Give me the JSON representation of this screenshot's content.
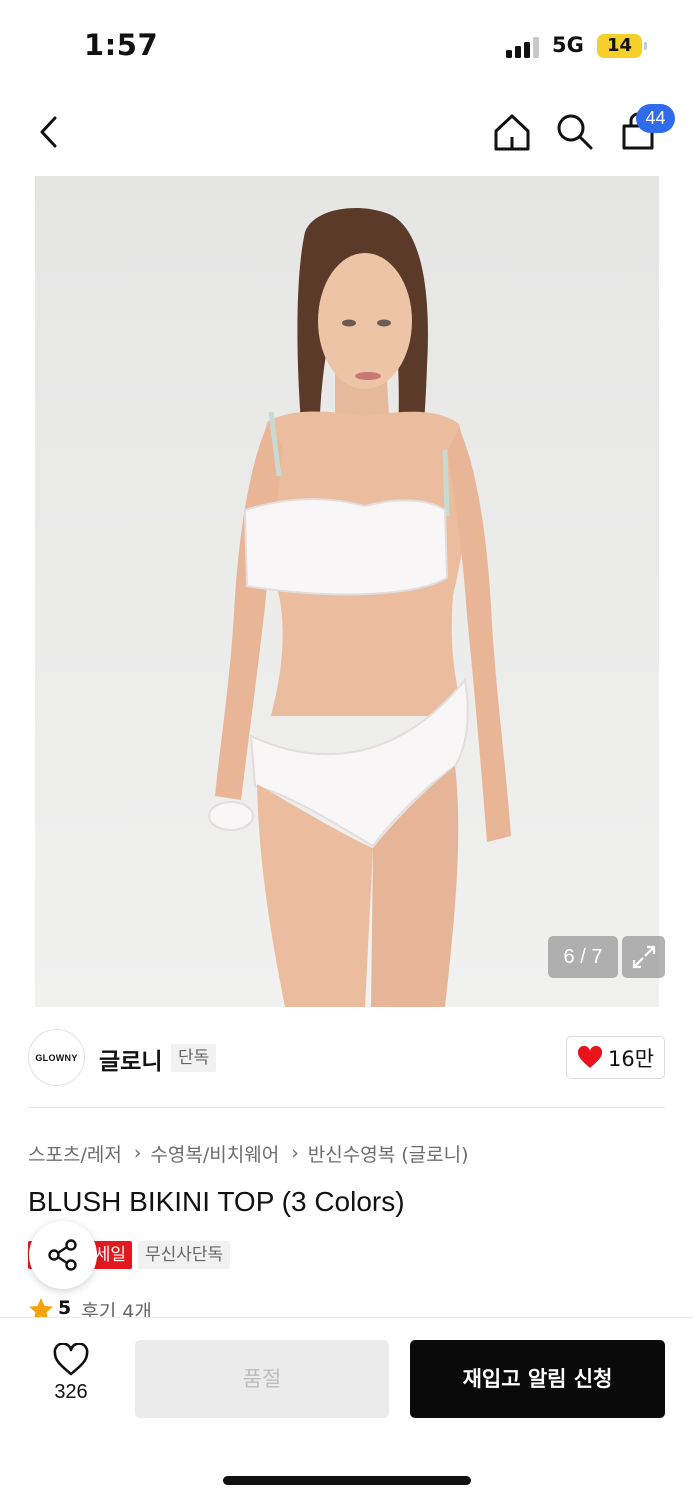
{
  "status_bar": {
    "time": "1:57",
    "network": "5G",
    "battery": "14"
  },
  "nav": {
    "cart_count": "44"
  },
  "image": {
    "counter": "6 / 7"
  },
  "brand": {
    "logo_text": "GLOWNY",
    "name": "글로니",
    "exclusive_tag": "단독",
    "like_count": "16만"
  },
  "breadcrumb": [
    "스포츠/레저",
    "수영복/비치웨어",
    "반신수영복 (글로니)"
  ],
  "product": {
    "title": "BLUSH BIKINI TOP (3 Colors)",
    "sale_tag": "세일",
    "musinsa_tag": "무신사단독",
    "rating": "5",
    "review_count": "후기 4개"
  },
  "bottom_bar": {
    "wish_count": "326",
    "soldout_label": "품절",
    "restock_label": "재입고 알림 신청"
  },
  "colors": {
    "cart_badge": "#2f6bea",
    "sale": "#e3171e",
    "heart": "#e8131c",
    "star": "#f4a30a",
    "battery": "#f5cf2a"
  },
  "icons": [
    "back-icon",
    "home-icon",
    "search-icon",
    "shopping-bag-icon",
    "expand-icon",
    "heart-icon",
    "share-icon",
    "star-icon"
  ]
}
